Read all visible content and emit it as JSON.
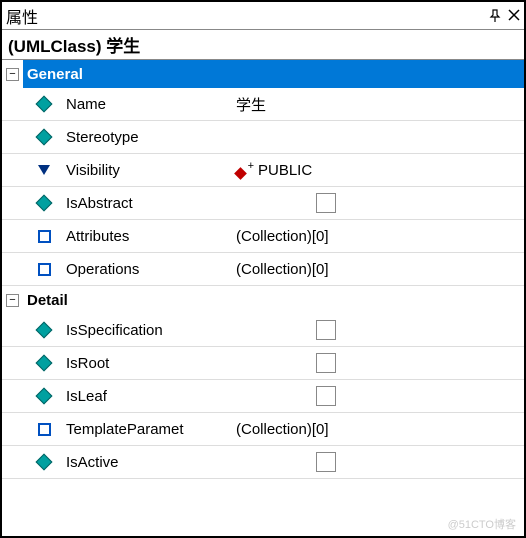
{
  "titlebar": {
    "title": "属性"
  },
  "subtitle": "(UMLClass) 学生",
  "sections": {
    "general": {
      "label": "General",
      "expand_symbol": "−",
      "rows": {
        "name": {
          "label": "Name",
          "value": "学生"
        },
        "stereotype": {
          "label": "Stereotype",
          "value": ""
        },
        "visibility": {
          "label": "Visibility",
          "value": "PUBLIC"
        },
        "isAbstract": {
          "label": "IsAbstract"
        },
        "attributes": {
          "label": "Attributes",
          "value": "(Collection)[0]"
        },
        "operations": {
          "label": "Operations",
          "value": "(Collection)[0]"
        }
      }
    },
    "detail": {
      "label": "Detail",
      "expand_symbol": "−",
      "rows": {
        "isSpecification": {
          "label": "IsSpecification"
        },
        "isRoot": {
          "label": "IsRoot"
        },
        "isLeaf": {
          "label": "IsLeaf"
        },
        "templateParam": {
          "label": "TemplateParamet",
          "value": "(Collection)[0]"
        },
        "isActive": {
          "label": "IsActive"
        }
      }
    }
  },
  "watermark": "@51CTO博客"
}
